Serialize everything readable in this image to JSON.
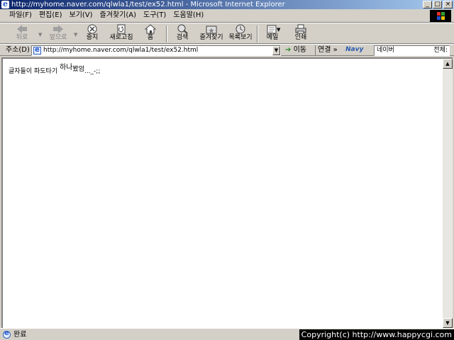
{
  "window": {
    "title": "http://myhome.naver.com/qlwla1/test/ex52.html - Microsoft Internet Explorer",
    "controls": [
      "_",
      "□",
      "×"
    ]
  },
  "menu": [
    "파일(F)",
    "편집(E)",
    "보기(V)",
    "즐겨찾기(A)",
    "도구(T)",
    "도움말(H)"
  ],
  "toolbar": {
    "back": "뒤로",
    "forward": "앞으로",
    "stop": "중지",
    "refresh": "새로고침",
    "home": "홈",
    "search": "검색",
    "favorites": "즐겨찾기",
    "history": "목록보기",
    "mail": "메일",
    "print": "인쇄"
  },
  "address": {
    "label": "주소(D)",
    "url": "http://myhome.naver.com/qlwla1/test/ex52.html",
    "go": "이동",
    "links": "연결 »",
    "navy": "Navy",
    "search_value": "네이버",
    "search_category": "전체:"
  },
  "page": {
    "text_main": "글자들이 파도타기",
    "text_wave1": "하나",
    "text_wave2": "봤엄",
    "text_tail": "..._-;;"
  },
  "status": {
    "text": "완료",
    "copyright": "Copyright(c) http://www.happycgi.com"
  },
  "colors": {
    "titlebar_start": "#0a246a",
    "titlebar_end": "#a6caf0",
    "chrome": "#d4d0c8",
    "content_bg": "#ffffff"
  }
}
